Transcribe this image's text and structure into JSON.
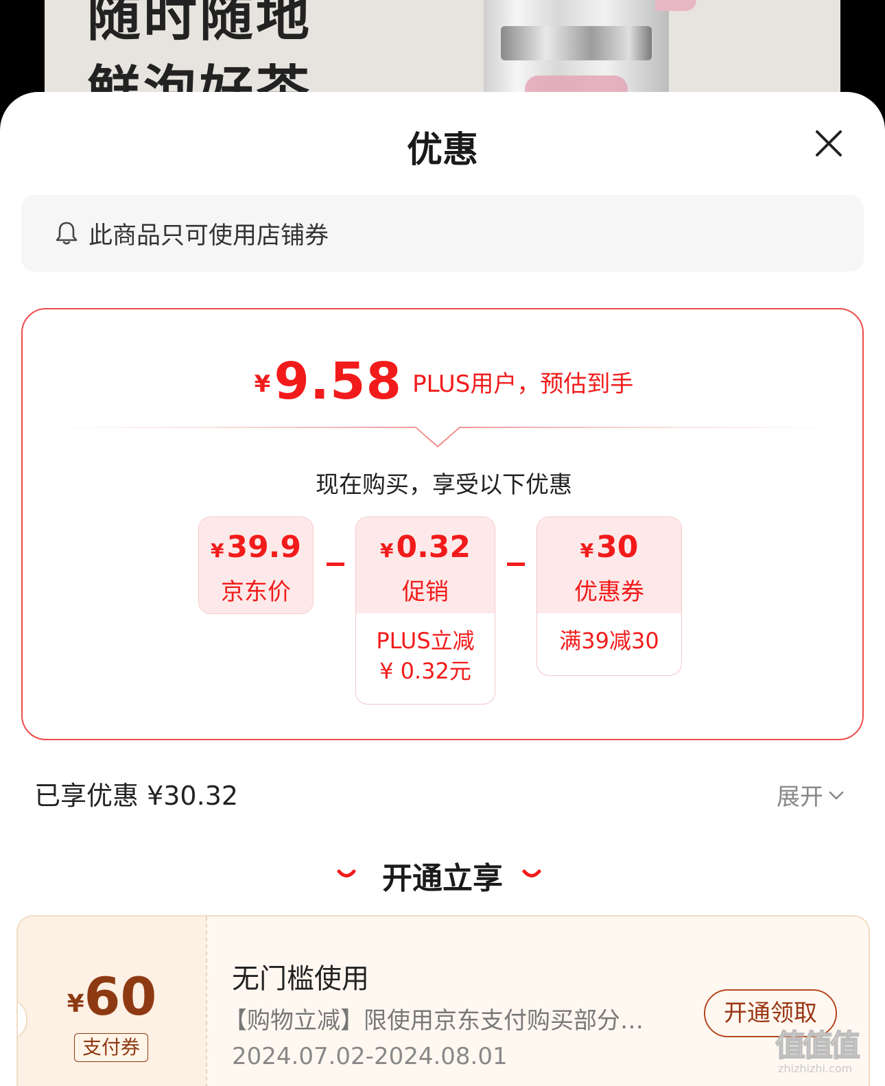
{
  "banner": {
    "line1": "随时随地",
    "line2": "鲜泡好茶"
  },
  "sheet": {
    "title": "优惠",
    "close_icon": "close-icon"
  },
  "notice": {
    "icon": "bell-icon",
    "text": "此商品只可使用店铺券"
  },
  "estimate": {
    "currency": "¥",
    "price": "9.58",
    "desc": "PLUS用户，预估到手",
    "subtitle": "现在购买，享受以下优惠",
    "items": [
      {
        "currency": "¥",
        "amount": "39.9",
        "label": "京东价"
      },
      {
        "currency": "¥",
        "amount": "0.32",
        "label": "促销",
        "detail_line1": "PLUS立减",
        "detail_line2": "¥ 0.32元"
      },
      {
        "currency": "¥",
        "amount": "30",
        "label": "优惠券",
        "detail_line1": "满39减30"
      }
    ]
  },
  "summary": {
    "enjoyed": "已享优惠 ¥30.32",
    "expand_label": "展开",
    "expand_icon": "chevron-down-icon"
  },
  "open_section": {
    "title": "开通立享"
  },
  "coupon": {
    "currency": "¥",
    "amount": "60",
    "tag": "支付券",
    "title": "无门槛使用",
    "desc": "【购物立减】限使用京东支付购买部分…",
    "date": "2024.07.02-2024.08.01",
    "button": "开通领取"
  },
  "watermark": {
    "glyphs": "值值值",
    "site": "zhizhizhi.com"
  },
  "colors": {
    "accent": "#f21b1b",
    "card_border": "#ef4a4a",
    "coupon_brown": "#8d3a12",
    "cell_bg": "#fde9e9"
  }
}
